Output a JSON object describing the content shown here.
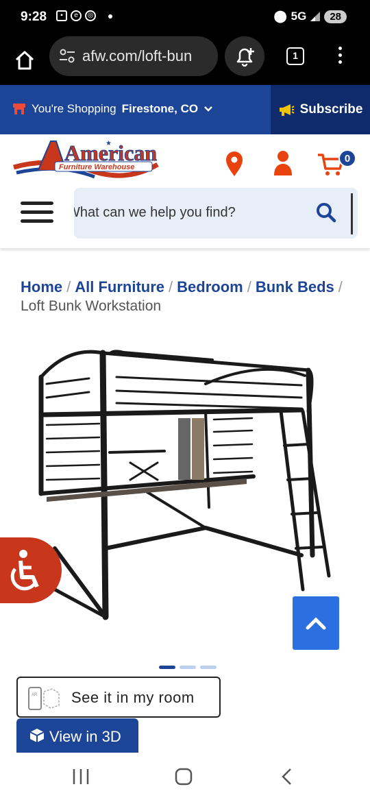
{
  "status_bar": {
    "time": "9:28",
    "network": "5G",
    "battery": "28"
  },
  "browser": {
    "url": "afw.com/loft-bun",
    "tab_count": "1"
  },
  "promo": {
    "shopping_label": "You're Shopping",
    "location": "Firestone, CO",
    "subscribe_label": "Subscribe"
  },
  "header": {
    "logo_name": "American",
    "logo_tagline": "Furniture Warehouse",
    "cart_count": "0",
    "search_placeholder": "What can we help you find?"
  },
  "breadcrumb": {
    "items": [
      "Home",
      "All Furniture",
      "Bedroom",
      "Bunk Beds"
    ],
    "current": "Loft Bunk Workstation"
  },
  "gallery": {
    "image_count": 3,
    "active_index": 0
  },
  "actions": {
    "see_in_room": "See it in my room",
    "view_3d": "View in 3D",
    "ar_label": "AR"
  },
  "colors": {
    "brand_blue": "#1d4597",
    "subscribe_bg": "#0f2b6b",
    "accent_red": "#c8361b",
    "scroll_top_blue": "#2c6fe0"
  }
}
